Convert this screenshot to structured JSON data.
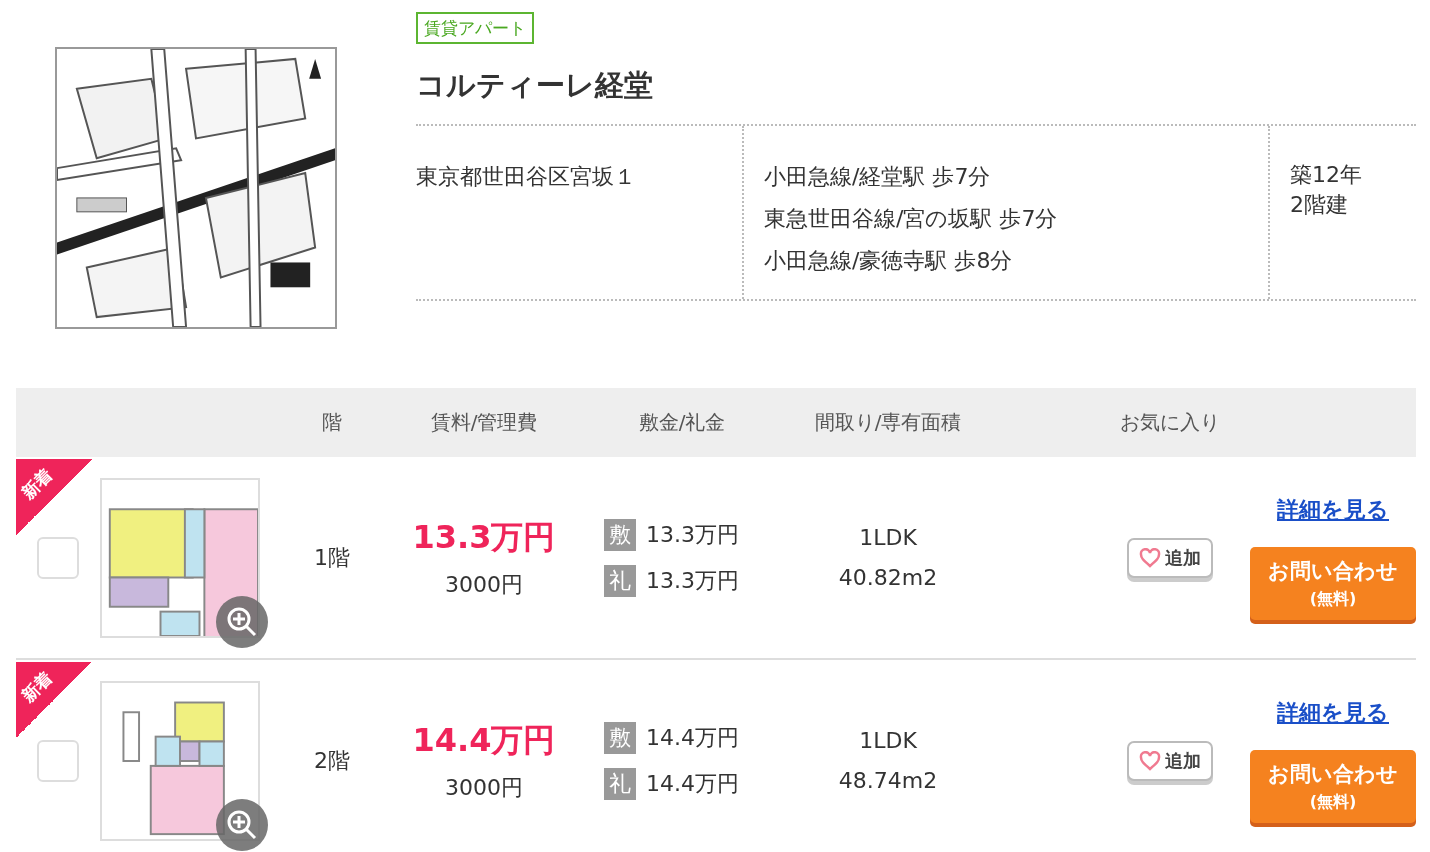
{
  "property": {
    "type_tag": "賃貸アパート",
    "name": "コルティーレ経堂",
    "address": "東京都世田谷区宮坂１",
    "access": [
      "小田急線/経堂駅 歩7分",
      "東急世田谷線/宮の坂駅 歩7分",
      "小田急線/豪徳寺駅 歩8分"
    ],
    "age": "築12年",
    "floors": "2階建"
  },
  "table": {
    "columns": [
      "階",
      "賃料/管理費",
      "敷金/礼金",
      "間取り/専有面積",
      "お気に入り"
    ]
  },
  "rooms": [
    {
      "badge": "新着",
      "checked": false,
      "floor": "1階",
      "rent": "13.3万円",
      "fee": "3000円",
      "deposit_label": "敷",
      "deposit": "13.3万円",
      "key_money_label": "礼",
      "key_money": "13.3万円",
      "layout": "1LDK",
      "area": "40.82m2",
      "favorite_label": "追加",
      "detail_link": "詳細を見る",
      "inquiry": "お問い合わせ",
      "inquiry_note": "(無料)"
    },
    {
      "badge": "新着",
      "checked": false,
      "floor": "2階",
      "rent": "14.4万円",
      "fee": "3000円",
      "deposit_label": "敷",
      "deposit": "14.4万円",
      "key_money_label": "礼",
      "key_money": "14.4万円",
      "layout": "1LDK",
      "area": "48.74m2",
      "favorite_label": "追加",
      "detail_link": "詳細を見る",
      "inquiry": "お問い合わせ",
      "inquiry_note": "(無料)"
    }
  ]
}
